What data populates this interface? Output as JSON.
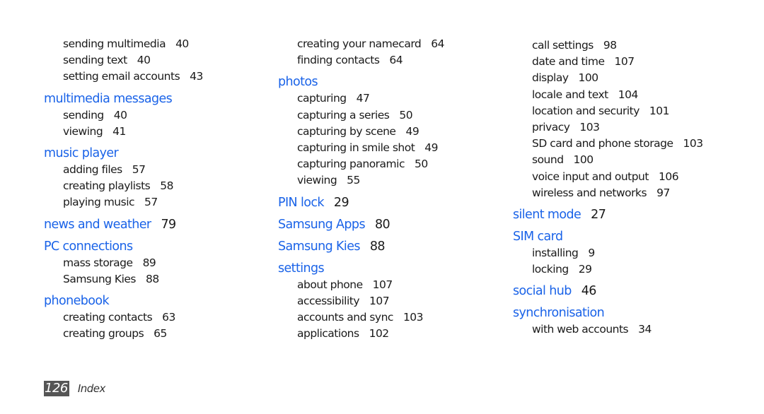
{
  "columns": [
    {
      "entries": [
        {
          "type": "sub",
          "label": "sending multimedia",
          "page": "40"
        },
        {
          "type": "sub",
          "label": "sending text",
          "page": "40"
        },
        {
          "type": "sub",
          "label": "setting email accounts",
          "page": "43"
        },
        {
          "type": "head",
          "label": "multimedia messages",
          "page": ""
        },
        {
          "type": "sub",
          "label": "sending",
          "page": "40"
        },
        {
          "type": "sub",
          "label": "viewing",
          "page": "41"
        },
        {
          "type": "head",
          "label": "music player",
          "page": ""
        },
        {
          "type": "sub",
          "label": "adding files",
          "page": "57"
        },
        {
          "type": "sub",
          "label": "creating playlists",
          "page": "58"
        },
        {
          "type": "sub",
          "label": "playing music",
          "page": "57"
        },
        {
          "type": "head",
          "label": "news and weather",
          "page": "79"
        },
        {
          "type": "head",
          "label": "PC connections",
          "page": ""
        },
        {
          "type": "sub",
          "label": "mass storage",
          "page": "89"
        },
        {
          "type": "sub",
          "label": "Samsung Kies",
          "page": "88"
        },
        {
          "type": "head",
          "label": "phonebook",
          "page": ""
        },
        {
          "type": "sub",
          "label": "creating contacts",
          "page": "63"
        },
        {
          "type": "sub",
          "label": "creating groups",
          "page": "65"
        }
      ]
    },
    {
      "entries": [
        {
          "type": "sub",
          "label": "creating your namecard",
          "page": "64"
        },
        {
          "type": "sub",
          "label": "finding contacts",
          "page": "64"
        },
        {
          "type": "head",
          "label": "photos",
          "page": ""
        },
        {
          "type": "sub",
          "label": "capturing",
          "page": "47"
        },
        {
          "type": "sub",
          "label": "capturing a series",
          "page": "50"
        },
        {
          "type": "sub",
          "label": "capturing by scene",
          "page": "49"
        },
        {
          "type": "sub",
          "label": "capturing in smile shot",
          "page": "49"
        },
        {
          "type": "sub",
          "label": "capturing panoramic",
          "page": "50"
        },
        {
          "type": "sub",
          "label": "viewing",
          "page": "55"
        },
        {
          "type": "head",
          "label": "PIN lock",
          "page": "29"
        },
        {
          "type": "head",
          "label": "Samsung Apps",
          "page": "80"
        },
        {
          "type": "head",
          "label": "Samsung Kies",
          "page": "88"
        },
        {
          "type": "head",
          "label": "settings",
          "page": ""
        },
        {
          "type": "sub",
          "label": "about phone",
          "page": "107"
        },
        {
          "type": "sub",
          "label": "accessibility",
          "page": "107"
        },
        {
          "type": "sub",
          "label": "accounts and sync",
          "page": "103"
        },
        {
          "type": "sub",
          "label": "applications",
          "page": "102"
        }
      ]
    },
    {
      "entries": [
        {
          "type": "sub",
          "label": "call settings",
          "page": "98"
        },
        {
          "type": "sub",
          "label": "date and time",
          "page": "107"
        },
        {
          "type": "sub",
          "label": "display",
          "page": "100"
        },
        {
          "type": "sub",
          "label": "locale and text",
          "page": "104"
        },
        {
          "type": "sub",
          "label": "location and security",
          "page": "101"
        },
        {
          "type": "sub",
          "label": "privacy",
          "page": "103"
        },
        {
          "type": "sub",
          "label": "SD card and phone storage",
          "page": "103"
        },
        {
          "type": "sub",
          "label": "sound",
          "page": "100"
        },
        {
          "type": "sub",
          "label": "voice input and output",
          "page": "106"
        },
        {
          "type": "sub",
          "label": "wireless and networks",
          "page": "97"
        },
        {
          "type": "head",
          "label": "silent mode",
          "page": "27"
        },
        {
          "type": "head",
          "label": "SIM card",
          "page": ""
        },
        {
          "type": "sub",
          "label": "installing",
          "page": "9"
        },
        {
          "type": "sub",
          "label": "locking",
          "page": "29"
        },
        {
          "type": "head",
          "label": "social hub",
          "page": "46"
        },
        {
          "type": "head",
          "label": "synchronisation",
          "page": ""
        },
        {
          "type": "sub",
          "label": "with web accounts",
          "page": "34"
        }
      ]
    }
  ],
  "footer": {
    "page_number": "126",
    "section": "Index"
  },
  "colors": {
    "heading": "#1a63e8",
    "text": "#1a1a1a",
    "page_badge": "#555555"
  }
}
